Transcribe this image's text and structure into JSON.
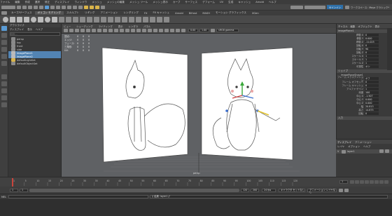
{
  "menubar": {
    "items": [
      "ファイル",
      "編集",
      "作成",
      "選択",
      "修正",
      "ディスプレイ",
      "ウィンドウ",
      "メッシュ",
      "メッシュの編集",
      "メッシュ ツール",
      "メッシュ表示",
      "カーブ",
      "サーフェス",
      "デフォーム",
      "UV",
      "生成",
      "キャッシュ",
      "Arnold",
      "ヘルプ"
    ]
  },
  "status": {
    "workspace": "ワークスペース:",
    "workspace_value": "Maya クラシック*",
    "signin": "サインイン"
  },
  "shelf_tabs": [
    "カーブ/サーフェス",
    "ポリゴン モデリング",
    "スカルプト",
    "リギング",
    "アニメーション",
    "レンダリング",
    "FX",
    "FX キャッシュ",
    "Arnold",
    "Bifrost",
    "MASH",
    "モーション グラフィックス",
    "XGen"
  ],
  "shelf_active": 1,
  "outliner": {
    "title": "アウトライナ",
    "menu": [
      "ディスプレイ",
      "表示",
      "ヘルプ"
    ],
    "search_placeholder": "検索...",
    "items": [
      {
        "label": "persp",
        "selected": false
      },
      {
        "label": "top",
        "selected": false
      },
      {
        "label": "front",
        "selected": false
      },
      {
        "label": "side",
        "selected": false
      },
      {
        "label": "imagePlane1",
        "selected": true
      },
      {
        "label": "imagePlane2",
        "selected": true
      },
      {
        "label": "defaultLightSet",
        "selected": false
      },
      {
        "label": "defaultObjectSet",
        "selected": false
      }
    ]
  },
  "viewport": {
    "menu": [
      "ビュー",
      "シェーディング",
      "ライティング",
      "表示",
      "レンダラ",
      "パネル"
    ],
    "hud": [
      {
        "label": "頂点:",
        "v1": "0",
        "v2": "0",
        "v3": "0"
      },
      {
        "label": "エッジ:",
        "v1": "0",
        "v2": "0",
        "v3": "0"
      },
      {
        "label": "フェース:",
        "v1": "0",
        "v2": "0",
        "v3": "0"
      },
      {
        "label": "三角形:",
        "v1": "0",
        "v2": "0",
        "v3": "0"
      },
      {
        "label": "UV:",
        "v1": "0",
        "v2": "0",
        "v3": "0"
      }
    ],
    "camera": "persp",
    "color_space": "sRGB gamma",
    "near": "0.00",
    "far": "1.00"
  },
  "attr": {
    "tabs": [
      "チャネル",
      "編集",
      "オブジェクト",
      "表示"
    ],
    "node": "imagePlaneShape1",
    "transform": "imagePlane1",
    "rows": [
      {
        "label": "移動 X",
        "value": "0"
      },
      {
        "label": "移動 Y",
        "value": "0.000"
      },
      {
        "label": "移動 Z",
        "value": "-11.025"
      },
      {
        "label": "回転 X",
        "value": "0"
      },
      {
        "label": "回転 Y",
        "value": "90"
      },
      {
        "label": "回転 Z",
        "value": "0"
      },
      {
        "label": "スケール X",
        "value": "1"
      },
      {
        "label": "スケール Y",
        "value": "1"
      },
      {
        "label": "スケール Z",
        "value": "1"
      },
      {
        "label": "可視性",
        "value": "オン"
      }
    ],
    "shape_title": "シェイプ",
    "shape_node": "imagePlaneShape1",
    "shape_rows": [
      {
        "label": "フレーム エクステンション",
        "value": "オフ"
      },
      {
        "label": "フレーム オフセット",
        "value": "0"
      },
      {
        "label": "フレーム キャッシュ",
        "value": "0"
      },
      {
        "label": "アルファ ゲイン",
        "value": "1"
      },
      {
        "label": "深度",
        "value": "100"
      },
      {
        "label": "中心 X",
        "value": "-1.507"
      },
      {
        "label": "中心 Y",
        "value": "0.000"
      },
      {
        "label": "中心 Z",
        "value": "0.000"
      },
      {
        "label": "幅",
        "value": "20.813"
      },
      {
        "label": "高さ",
        "value": "14.875"
      },
      {
        "label": "回転",
        "value": "0"
      }
    ],
    "inputs": "入力"
  },
  "layers": {
    "tabs": [
      "ディスプレイ",
      "アニメーション"
    ],
    "menu": [
      "レイヤ",
      "オプション",
      "ヘルプ"
    ],
    "items": [
      {
        "label": "layer1",
        "v": "V"
      }
    ]
  },
  "timeline": {
    "ticks": [
      "1",
      "5",
      "10",
      "15",
      "20",
      "25",
      "30",
      "35",
      "40",
      "45",
      "50",
      "55",
      "60",
      "65",
      "70",
      "75",
      "80",
      "85",
      "90",
      "95",
      "100",
      "105",
      "110",
      "115",
      "120"
    ],
    "current": "1",
    "start": "1",
    "end": "120",
    "range_start": "1",
    "range_end": "200",
    "char_set": "キャラクタ セットなし",
    "anim_layer": "アニメーション レイヤなし",
    "fps": "24 fps"
  },
  "cmdline": {
    "label": "MEL",
    "help": "// 結果: layer1 //"
  },
  "logo": {
    "text": "M"
  }
}
